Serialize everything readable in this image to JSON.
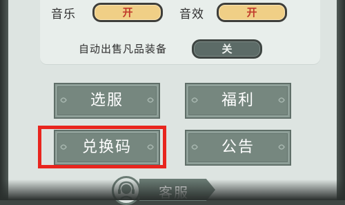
{
  "settings": {
    "music_label": "音乐",
    "music_value": "开",
    "sfx_label": "音效",
    "sfx_value": "开",
    "auto_sell_label": "自动出售凡品装备",
    "auto_sell_value": "关"
  },
  "buttons": {
    "select_server": "选服",
    "welfare": "福利",
    "redeem_code": "兑换码",
    "announcement": "公告"
  },
  "customer_service": {
    "label": "客服"
  },
  "colors": {
    "toggle_on": "#f0cf86",
    "toggle_off": "#5c6b67",
    "button": "#76877f",
    "highlight": "#e8251e"
  }
}
